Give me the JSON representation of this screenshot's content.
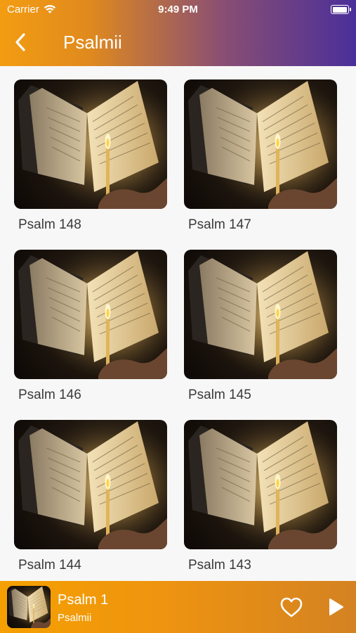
{
  "status_bar": {
    "carrier": "Carrier",
    "time": "9:49 PM"
  },
  "header": {
    "title": "Psalmii",
    "back_icon": "chevron-left-icon"
  },
  "colors": {
    "header_start": "#f39c12",
    "header_end": "#4a2f9a",
    "player": "#f5a000",
    "label_text": "#3a3a3a"
  },
  "psalms": [
    {
      "label": "Psalm 148"
    },
    {
      "label": "Psalm 147"
    },
    {
      "label": "Psalm 146"
    },
    {
      "label": "Psalm 145"
    },
    {
      "label": "Psalm 144"
    },
    {
      "label": "Psalm 143"
    }
  ],
  "player": {
    "title": "Psalm 1",
    "subtitle": "Psalmii",
    "favorite_icon": "heart-outline-icon",
    "play_icon": "play-icon"
  }
}
